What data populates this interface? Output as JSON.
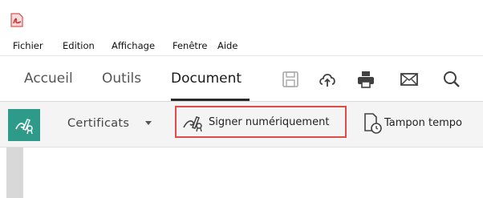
{
  "app": {
    "icon": "pdf-app-icon"
  },
  "menu": {
    "items": [
      "Fichier",
      "Edition",
      "Affichage",
      "Fenêtre",
      "Aide"
    ]
  },
  "nav": {
    "tabs": [
      {
        "label": "Accueil",
        "active": false
      },
      {
        "label": "Outils",
        "active": false
      },
      {
        "label": "Document",
        "active": true
      }
    ],
    "tools": [
      "save-icon",
      "cloud-upload-icon",
      "print-icon",
      "mail-icon",
      "search-icon"
    ]
  },
  "ribbon": {
    "certificats_label": "Certificats",
    "signer_label": "Signer numériquement",
    "tampon_label": "Tampon tempo",
    "colors": {
      "accent": "#2e9a8a",
      "highlight_border": "#e04b48"
    }
  }
}
